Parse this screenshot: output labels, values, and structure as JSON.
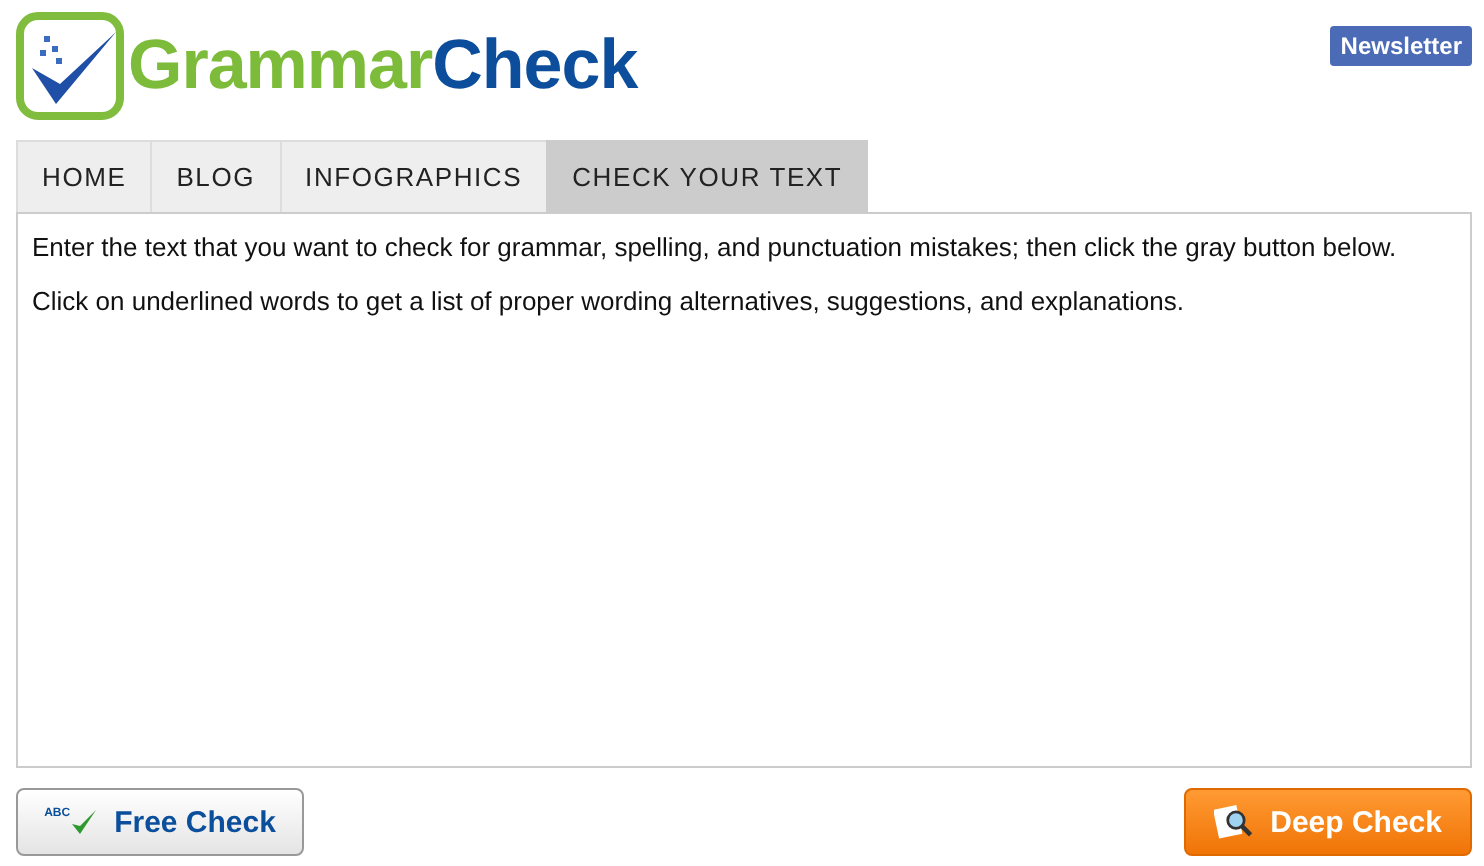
{
  "logo": {
    "part_1": "Grammar",
    "part_2": "Check"
  },
  "newsletter": "Newsletter",
  "tabs": [
    {
      "label": "HOME",
      "selected": false
    },
    {
      "label": "BLOG",
      "selected": false
    },
    {
      "label": "INFOGRAPHICS",
      "selected": false
    },
    {
      "label": "CHECK YOUR TEXT",
      "selected": true
    }
  ],
  "editor": {
    "paragraphs": [
      "Enter the text that you want to check for grammar, spelling, and punctuation mistakes; then click the gray button below.",
      "Click on underlined words to get a list of proper wording alternatives, suggestions, and explanations."
    ]
  },
  "buttons": [
    {
      "kind": "free",
      "label": "Free Check",
      "icon_text": "ABC"
    },
    {
      "kind": "deep",
      "label": "Deep Check"
    }
  ]
}
